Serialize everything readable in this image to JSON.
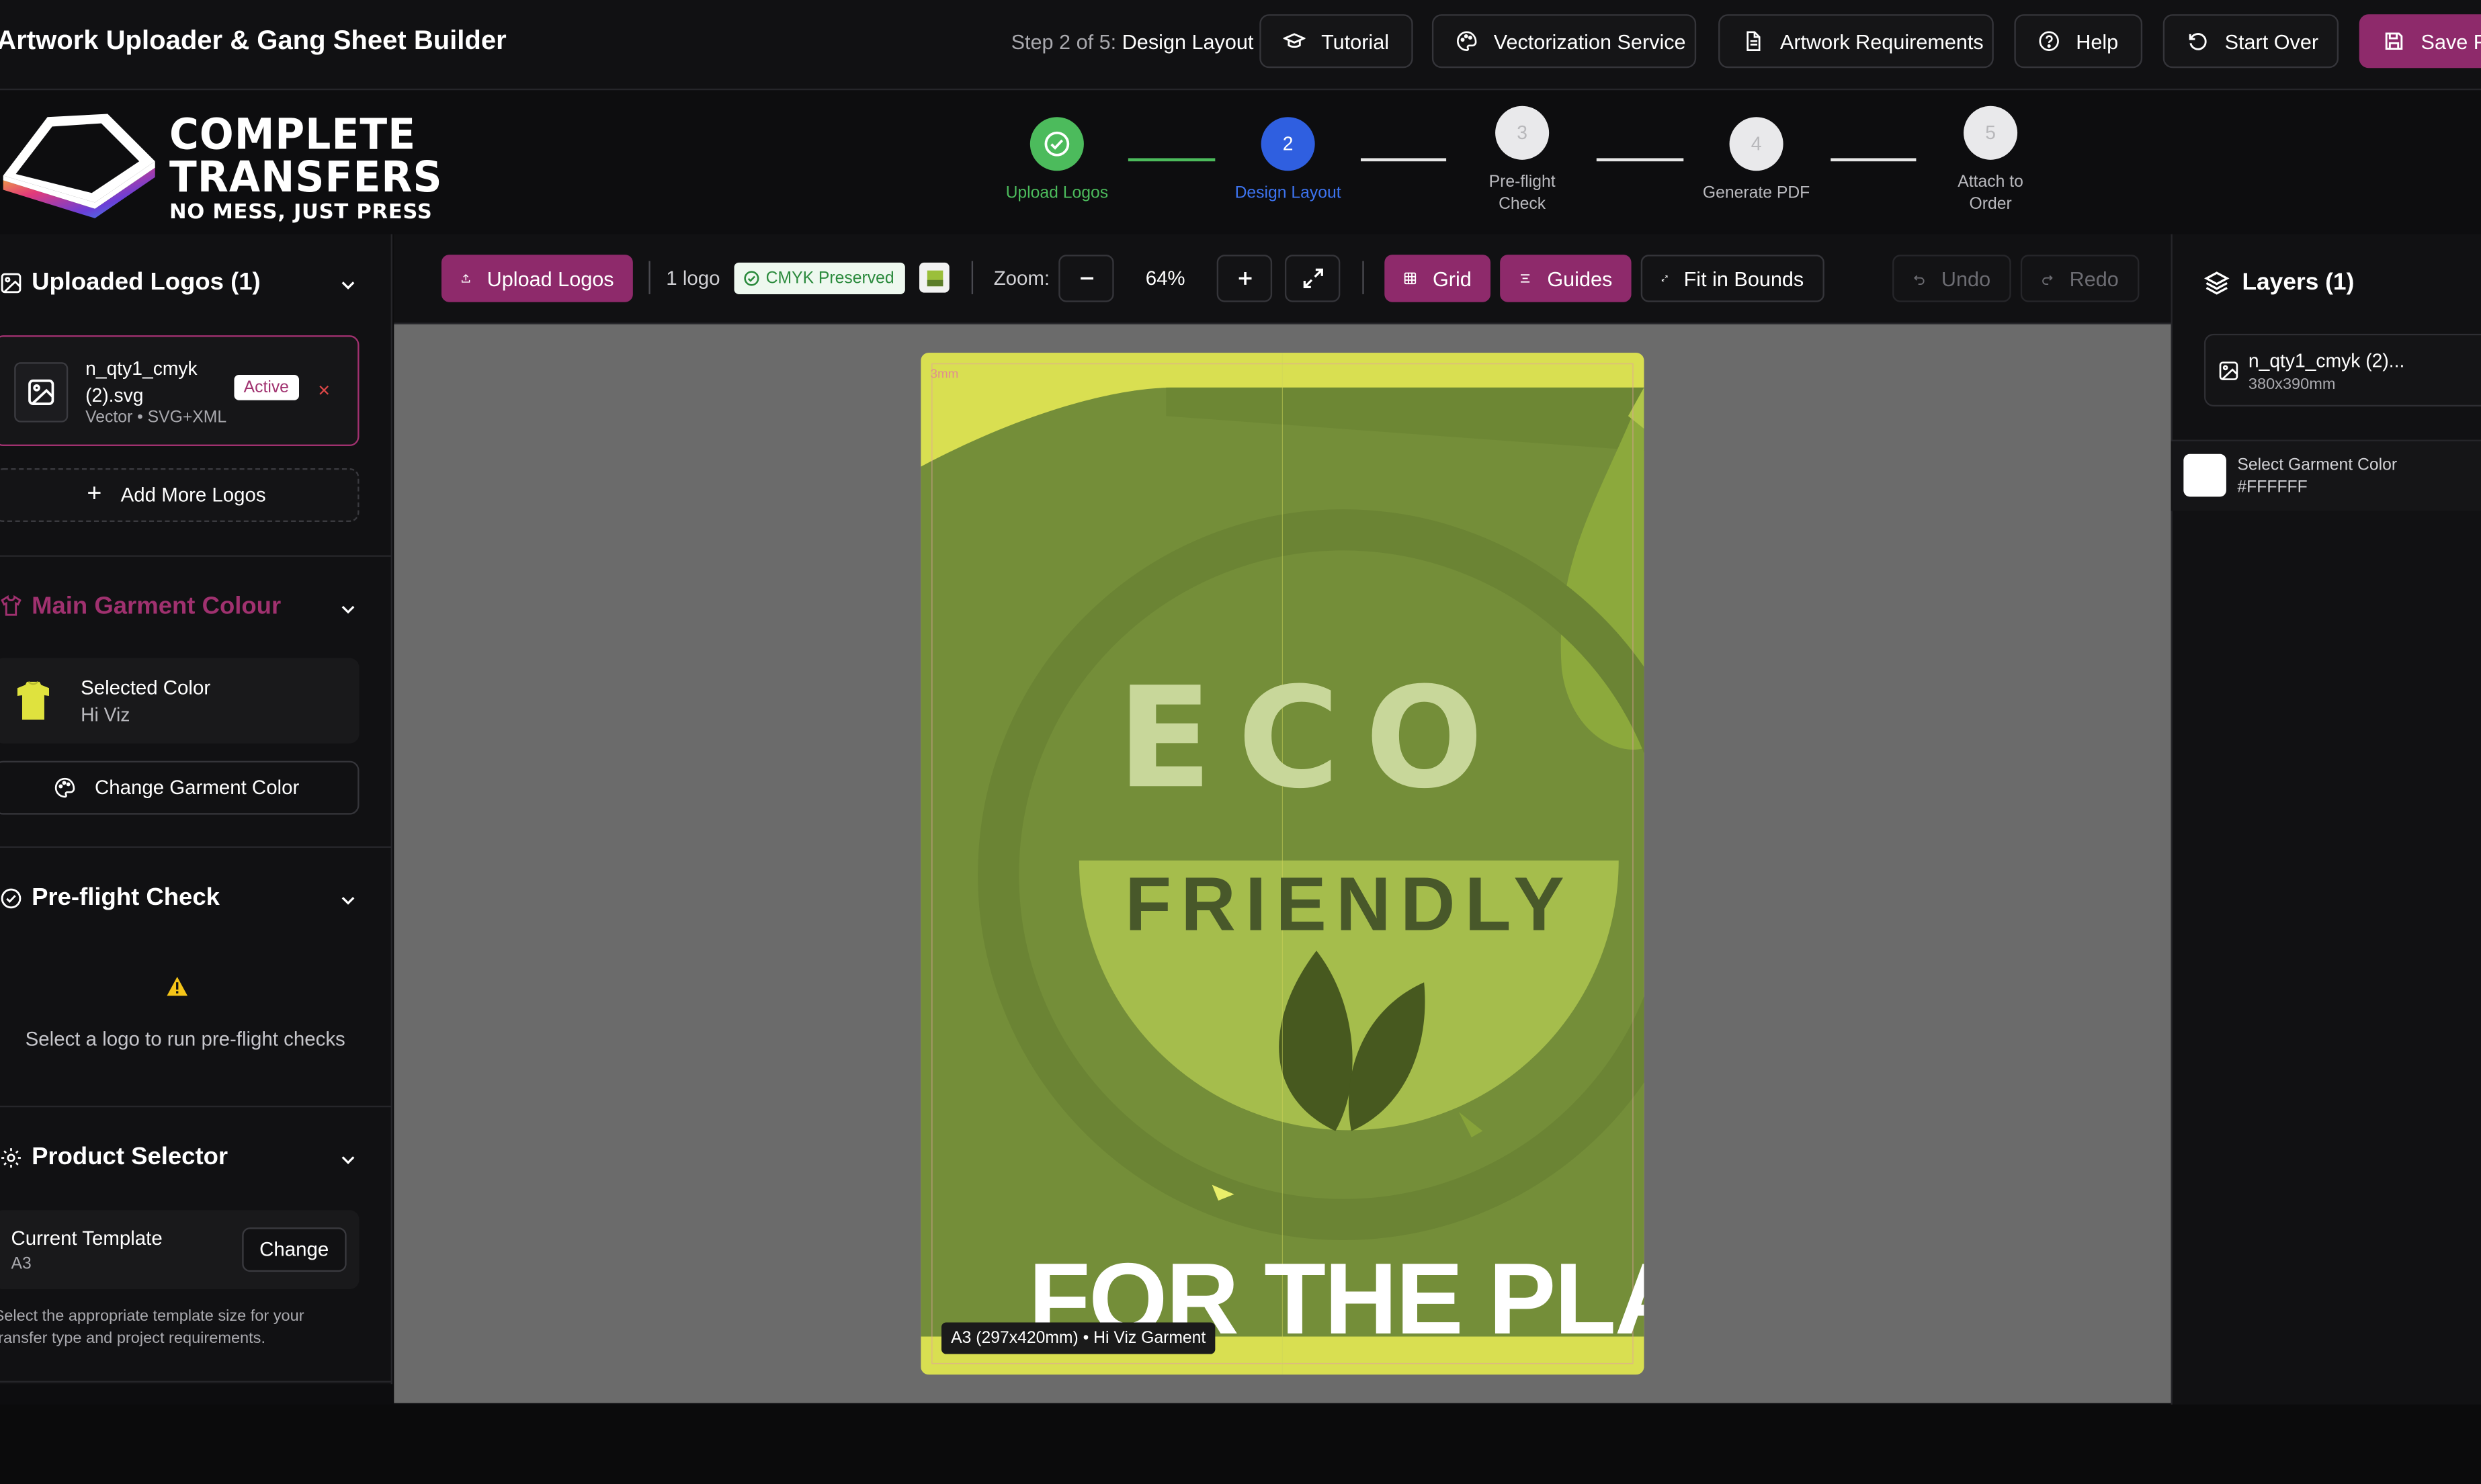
{
  "header": {
    "app_title": "Artwork Uploader & Gang Sheet Builder",
    "step_prefix": "Step 2 of 5:",
    "step_name": "Design Layout",
    "buttons": {
      "tutorial": "Tutorial",
      "vectorization": "Vectorization Service",
      "requirements": "Artwork Requirements",
      "help": "Help",
      "start_over": "Start Over",
      "save": "Save F"
    }
  },
  "brand": {
    "line1": "COMPLETE",
    "line2": "TRANSFERS",
    "tagline": "NO MESS, JUST PRESS"
  },
  "stepper": {
    "steps": [
      {
        "num": "1",
        "label": "Upload Logos",
        "state": "done"
      },
      {
        "num": "2",
        "label": "Design Layout",
        "state": "active"
      },
      {
        "num": "3",
        "label": "Pre-flight Check",
        "state": "pending"
      },
      {
        "num": "4",
        "label": "Generate PDF",
        "state": "pending"
      },
      {
        "num": "5",
        "label": "Attach to Order",
        "state": "pending"
      }
    ]
  },
  "left": {
    "uploaded_title": "Uploaded Logos (1)",
    "file_name": "n_qty1_cmyk (2).svg",
    "file_meta": "Vector • SVG+XML",
    "active_badge": "Active",
    "remove_glyph": "×",
    "add_more": "Add More Logos",
    "garment_title": "Main Garment Colour",
    "selected_color_label": "Selected Color",
    "selected_color_name": "Hi Viz",
    "change_color_btn": "Change Garment Color",
    "preflight_title": "Pre-flight Check",
    "preflight_msg": "Select a logo to run pre-flight checks",
    "product_title": "Product Selector",
    "current_template_label": "Current Template",
    "current_template_value": "A3",
    "change_btn": "Change",
    "product_help": "Select the appropriate template size for your transfer type and project requirements."
  },
  "toolbar": {
    "upload": "Upload Logos",
    "logo_count": "1 logo",
    "cmyk_badge": "CMYK Preserved",
    "zoom_label": "Zoom:",
    "zoom_value": "64%",
    "grid": "Grid",
    "guides": "Guides",
    "fit": "Fit in Bounds",
    "undo": "Undo",
    "redo": "Redo"
  },
  "canvas": {
    "bleed_label": "3mm",
    "size_label": "A3 (297x420mm) • Hi Viz Garment",
    "art_word1": "ECO",
    "art_word2": "FRIENDLY",
    "art_word3": "FOR THE PLA"
  },
  "right": {
    "layers_title": "Layers (1)",
    "layer_name": "n_qty1_cmyk (2)...",
    "layer_size": "380x390mm",
    "garment_label": "Select Garment Color",
    "garment_hex": "#FFFFFF"
  },
  "colors": {
    "accent": "#8e2a6b",
    "hi_viz": "#d9df51",
    "step_done": "#4cbb5c",
    "step_active": "#2f5fe0"
  }
}
